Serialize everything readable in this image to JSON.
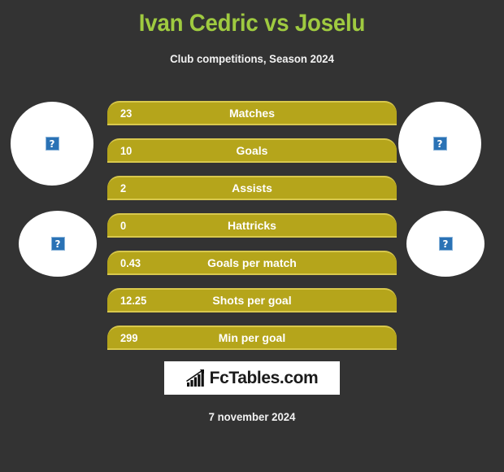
{
  "header": {
    "title": "Ivan Cedric vs Joselu",
    "subtitle": "Club competitions, Season 2024",
    "title_color": "#9fca40",
    "subtitle_color": "#f2f2f2"
  },
  "theme": {
    "background": "#333333",
    "bar_fill": "#b5a51b",
    "bar_outline": "#d8c84c",
    "bar_text": "#ffffff",
    "placeholder_blue": "#2a72b5"
  },
  "players": {
    "left": {
      "photo_top": {
        "icon": "broken-image-icon",
        "glyph": "?"
      },
      "photo_bottom": {
        "icon": "broken-image-icon",
        "glyph": "?"
      }
    },
    "right": {
      "photo_top": {
        "icon": "broken-image-icon",
        "glyph": "?"
      },
      "photo_bottom": {
        "icon": "broken-image-icon",
        "glyph": "?"
      }
    }
  },
  "chart_data": {
    "type": "bar",
    "title": "Ivan Cedric vs Joselu",
    "subtitle": "Club competitions, Season 2024",
    "xlabel": "",
    "ylabel": "",
    "orientation": "horizontal",
    "categories": [
      "Matches",
      "Goals",
      "Assists",
      "Hattricks",
      "Goals per match",
      "Shots per goal",
      "Min per goal"
    ],
    "values": [
      23,
      10,
      2,
      0,
      0.43,
      12.25,
      299
    ],
    "value_labels": [
      "23",
      "10",
      "2",
      "0",
      "0.43",
      "12.25",
      "299"
    ],
    "note": "All bars rendered at full width; value shown as text label at left of each bar."
  },
  "stats": [
    {
      "value": "23",
      "label": "Matches"
    },
    {
      "value": "10",
      "label": "Goals"
    },
    {
      "value": "2",
      "label": "Assists"
    },
    {
      "value": "0",
      "label": "Hattricks"
    },
    {
      "value": "0.43",
      "label": "Goals per match"
    },
    {
      "value": "12.25",
      "label": "Shots per goal"
    },
    {
      "value": "299",
      "label": "Min per goal"
    }
  ],
  "footer": {
    "logo_text": "FcTables.com",
    "logo_icon": "bar-chart-trend-icon",
    "date": "7 november 2024"
  }
}
